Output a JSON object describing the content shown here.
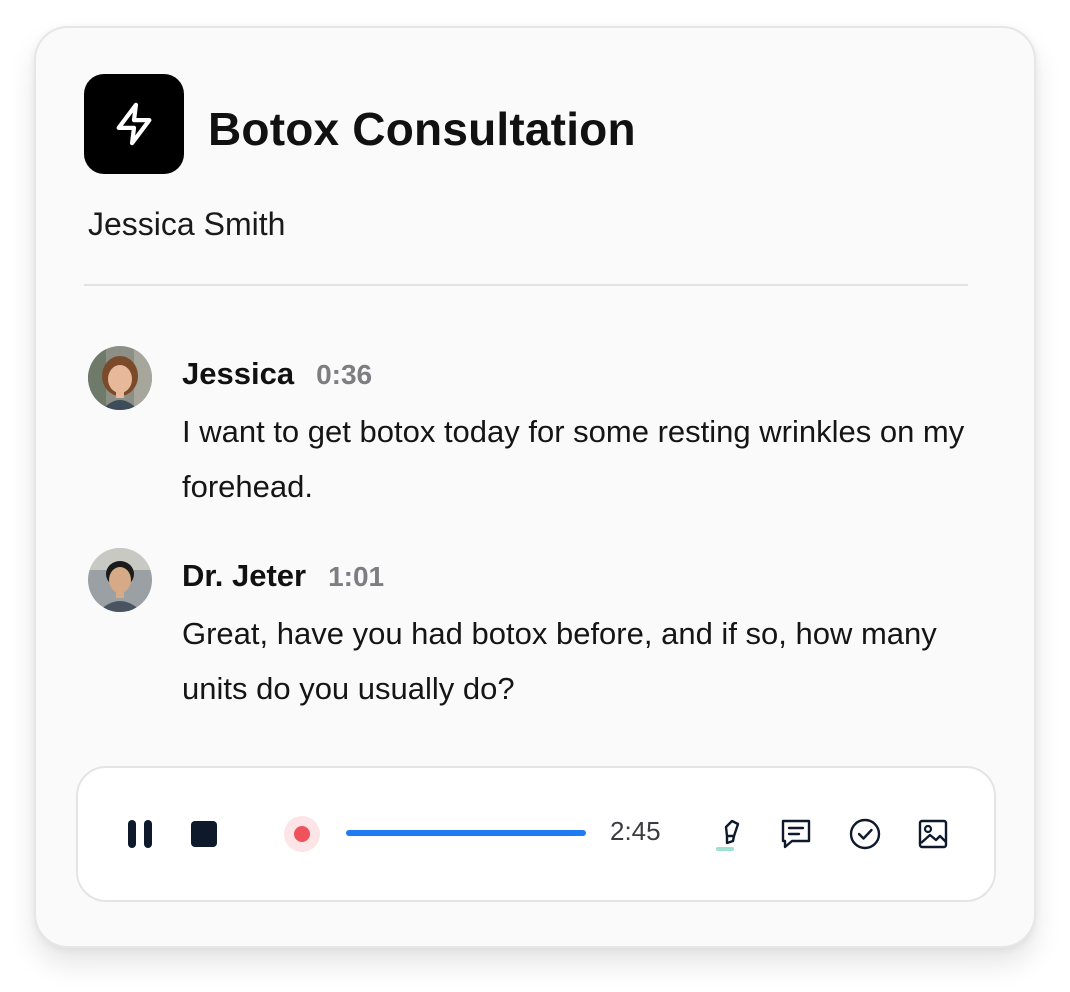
{
  "header": {
    "app_icon": "lightning-bolt-icon",
    "title": "Botox Consultation",
    "patient_name": "Jessica Smith"
  },
  "transcript": [
    {
      "speaker": "Jessica",
      "time": "0:36",
      "text": "I want to get botox today for some resting wrinkles on my forehead.",
      "avatar": "patient-photo"
    },
    {
      "speaker": "Dr. Jeter",
      "time": "1:01",
      "text": "Great, have you had botox before, and if so, how many units do you usually do?",
      "avatar": "doctor-photo"
    }
  ],
  "player": {
    "controls": [
      "pause-icon",
      "stop-icon"
    ],
    "recording_indicator": "record-dot-icon",
    "progress": 1.0,
    "duration": "2:45",
    "actions": [
      "highlighter-icon",
      "comment-icon",
      "check-circle-icon",
      "image-icon"
    ]
  },
  "colors": {
    "accent": "#1e7cf2",
    "record": "#f0525c",
    "record_halo": "#fde4e6",
    "control": "#0e1a2b",
    "highlighter_tint": "#9fe0cf"
  }
}
